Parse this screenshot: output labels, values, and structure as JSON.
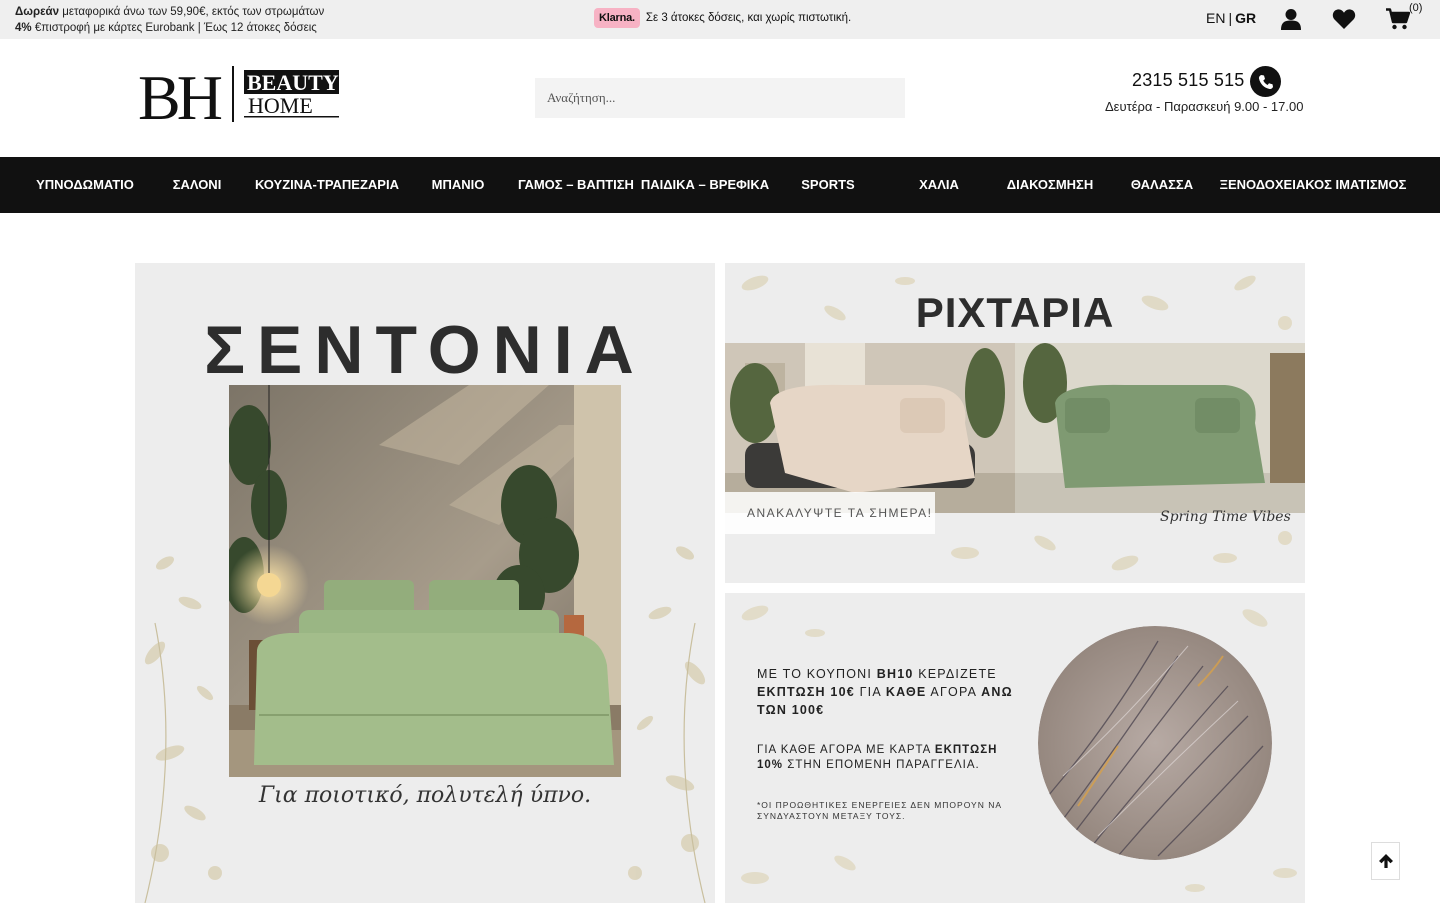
{
  "topbar": {
    "promo_line1_bold": "Δωρεάν",
    "promo_line1_rest": " μεταφορικά άνω των 59,90€, εκτός των στρωμάτων",
    "promo_line2_bold": "4%",
    "promo_line2_rest": " €πιστροφή με κάρτες Eurobank | Έως 12 άτοκες δόσεις",
    "klarna_badge": "Klarna.",
    "klarna_text": "Σε 3 άτοκες δόσεις, και χωρίς πιστωτική.",
    "lang_en": "EN",
    "lang_sep": "|",
    "lang_gr": "GR",
    "cart_count": "(0)",
    "icons": [
      "user-icon",
      "heart-icon",
      "cart-icon"
    ]
  },
  "header": {
    "logo_initials": "BH",
    "logo_word1": "BEAUTY",
    "logo_word2": "HOME",
    "search_placeholder": "Αναζήτηση...",
    "phone": "2315 515 515",
    "hours": "Δευτέρα - Παρασκευή 9.00 - 17.00"
  },
  "nav": {
    "items": [
      "ΥΠΝΟΔΩΜΑΤΙΟ",
      "ΣΑΛΟΝΙ",
      "ΚΟΥΖΙΝΑ-ΤΡΑΠΕΖΑΡΙΑ",
      "ΜΠΑΝΙΟ",
      "ΓΑΜΟΣ – ΒΑΠΤΙΣΗ",
      "ΠΑΙΔΙΚΑ – ΒΡΕΦΙΚΑ",
      "SPORTS",
      "ΧΑΛΙΑ",
      "ΔΙΑΚΟΣΜΗΣΗ",
      "ΘΑΛΑΣΣΑ",
      "ΞΕΝΟΔΟΧΕΙΑΚΟΣ ΙΜΑΤΙΣΜΟΣ"
    ]
  },
  "banners": {
    "sheets": {
      "title": "ΣΕΝΤΟΝΙΑ",
      "caption": "Για ποιοτικό, πολυτελή ύπνο."
    },
    "throws": {
      "title": "ΡΙΧΤΑΡΙΑ",
      "cta": "ΑΝΑΚΑΛΥΨΤΕ ΤΑ ΣΗΜΕΡΑ!",
      "signature": "Spring Time Vibes"
    },
    "coupon": {
      "line1_a": "ΜΕ ΤΟ ΚΟΥΠΟΝΙ ",
      "line1_code": "BH10",
      "line1_b": " ΚΕΡΔΙΖΕΤΕ",
      "line2_a": "ΕΚΠΤΩΣΗ 10€",
      "line2_b": " ΓΙΑ ",
      "line2_c": "ΚΑΘΕ",
      "line2_d": " ΑΓΟΡΑ ",
      "line2_e": "ΑΝΩ ΤΩΝ 100€",
      "card_a": "ΓΙΑ ΚΑΘΕ ΑΓΟΡΑ ΜΕ ΚΑΡΤΑ ",
      "card_b": "ΕΚΠΤΩΣΗ 10%",
      "card_c": " ΣΤΗΝ ΕΠΟΜΕΝΗ ΠΑΡΑΓΓΕΛΙΑ.",
      "note": "*ΟΙ ΠΡΟΩΘΗΤΙΚΕΣ ΕΝΕΡΓΕΙΕΣ ΔΕΝ ΜΠΟΡΟΥΝ ΝΑ ΣΥΝΔΥΑΣΤΟΥΝ ΜΕΤΑΞΥ ΤΟΥΣ."
    }
  },
  "colors": {
    "topbar_bg": "#efefef",
    "nav_bg": "#111111",
    "klarna_pink": "#f7b2c4",
    "banner_bg": "#ededed"
  }
}
